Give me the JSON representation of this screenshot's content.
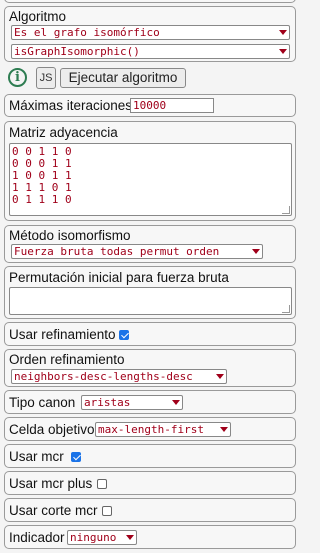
{
  "algoritmo": {
    "label": "Algoritmo",
    "select_value": "Es el grafo isomórfico",
    "function_value": "isGraphIsomorphic()"
  },
  "actions": {
    "info_icon": "i",
    "js_label": "JS",
    "run_label": "Ejecutar algoritmo"
  },
  "max_iter": {
    "label": "Máximas iteraciones",
    "value": "10000"
  },
  "matriz": {
    "label": "Matriz adyacencia",
    "rows": [
      "0 0 1 1 0",
      "0 0 0 1 1",
      "1 0 0 1 1",
      "1 1 1 0 1",
      "0 1 1 1 0"
    ]
  },
  "metodo": {
    "label": "Método isomorfismo",
    "value": "Fuerza bruta todas permut orden"
  },
  "permutacion": {
    "label": "Permutación inicial para fuerza bruta",
    "value": ""
  },
  "refinamiento": {
    "label": "Usar refinamiento",
    "checked": true
  },
  "orden": {
    "label": "Orden refinamiento",
    "value": "neighbors-desc-lengths-desc"
  },
  "canon": {
    "label": "Tipo canon",
    "value": "aristas"
  },
  "celda": {
    "label": "Celda objetivo",
    "value": "max-length-first"
  },
  "mcr": {
    "label": "Usar mcr",
    "checked": true
  },
  "mcr_plus": {
    "label": "Usar mcr plus",
    "checked": false
  },
  "corte_mcr": {
    "label": "Usar corte mcr",
    "checked": false
  },
  "indicador": {
    "label": "Indicador",
    "value": "ninguno"
  },
  "colors": {
    "accent": "#1a73e8",
    "select_text": "#a0001a",
    "info": "#2e7d52"
  }
}
